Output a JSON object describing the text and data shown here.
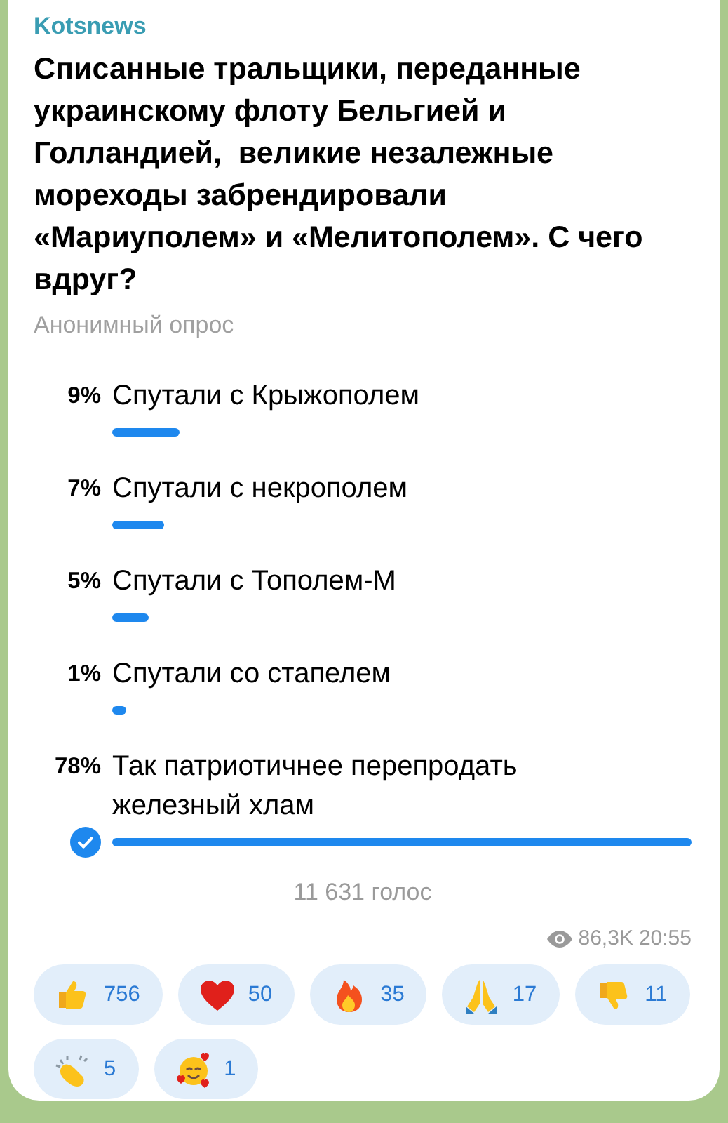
{
  "channel": "Kotsnews",
  "question": "Списанные тральщики, переданные украинскому флоту Бельгией и Голландией,  великие незалежные мореходы забрендировали «Мариуполем» и «Мелитополем». С чего вдруг?",
  "poll_type": "Анонимный опрос",
  "options": [
    {
      "percent": "9%",
      "label": "Спутали с Крыжополем",
      "selected": false
    },
    {
      "percent": "7%",
      "label": "Спутали с некрополем",
      "selected": false
    },
    {
      "percent": "5%",
      "label": "Спутали с Тополем-М",
      "selected": false
    },
    {
      "percent": "1%",
      "label": "Спутали со стапелем",
      "selected": false
    },
    {
      "percent": "78%",
      "label": "Так патриотичнее перепродать железный хлам",
      "selected": true
    }
  ],
  "votes": "11 631 голос",
  "views": "86,3K",
  "time": "20:55",
  "reactions": [
    {
      "kind": "thumbsup",
      "count": "756"
    },
    {
      "kind": "heart",
      "count": "50"
    },
    {
      "kind": "fire",
      "count": "35"
    },
    {
      "kind": "pray",
      "count": "17"
    },
    {
      "kind": "thumbsdown",
      "count": "11"
    },
    {
      "kind": "clap",
      "count": "5"
    },
    {
      "kind": "lovingface",
      "count": "1"
    }
  ]
}
